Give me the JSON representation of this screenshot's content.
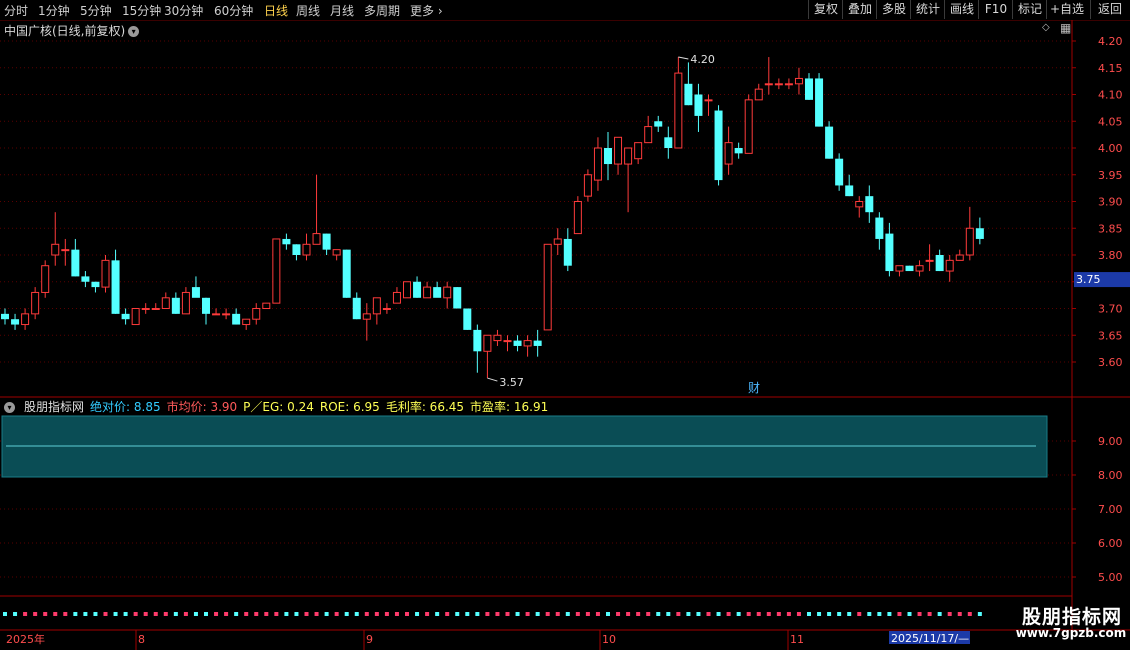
{
  "toolbar": {
    "periods": [
      "分时",
      "1分钟",
      "5分钟",
      "15分钟",
      "30分钟",
      "60分钟",
      "日线",
      "周线",
      "月线",
      "多周期",
      "更多"
    ],
    "active_period": "日线",
    "buttons": [
      "复权",
      "叠加",
      "多股",
      "统计",
      "画线",
      "F10",
      "标记",
      "+自选",
      "返回"
    ]
  },
  "main": {
    "title": "中国广核(日线,前复权)",
    "price_ticks": [
      "4.20",
      "4.15",
      "4.10",
      "4.05",
      "4.00",
      "3.95",
      "3.90",
      "3.85",
      "3.80",
      "3.75",
      "3.70",
      "3.65",
      "3.60"
    ],
    "current_price": "3.75",
    "high_label": "4.20",
    "low_label": "3.57",
    "fin_marker": "财"
  },
  "indicator": {
    "name": "股朋指标网",
    "fields": [
      {
        "label": "绝对价:",
        "value": "8.85",
        "color": "#33ccff"
      },
      {
        "label": "市均价:",
        "value": "3.90",
        "color": "#ff5a5a"
      },
      {
        "label": "P／EG:",
        "value": "0.24",
        "color": "#ffff55"
      },
      {
        "label": "ROE:",
        "value": "6.95",
        "color": "#ffff55"
      },
      {
        "label": "毛利率:",
        "value": "66.45",
        "color": "#ffff55"
      },
      {
        "label": "市盈率:",
        "value": "16.91",
        "color": "#ffff55"
      }
    ],
    "ticks": [
      "9.00",
      "8.00",
      "7.00",
      "6.00",
      "5.00"
    ]
  },
  "date_axis": {
    "labels": [
      "2025年",
      "8",
      "9",
      "10",
      "11"
    ],
    "cursor_date": "2025/11/17/—"
  },
  "watermark": {
    "name": "股朋指标网",
    "url": "www.7gpzb.com"
  },
  "colors": {
    "up": "#ff3b3b",
    "down": "#54ffff",
    "grid": "#5a0000",
    "axis": "#a00000"
  },
  "chart_data": {
    "type": "candlestick",
    "ylim": [
      3.56,
      4.22
    ],
    "candles": [
      {
        "o": 3.69,
        "h": 3.7,
        "l": 3.67,
        "c": 3.68
      },
      {
        "o": 3.68,
        "h": 3.69,
        "l": 3.66,
        "c": 3.67
      },
      {
        "o": 3.67,
        "h": 3.7,
        "l": 3.66,
        "c": 3.69
      },
      {
        "o": 3.69,
        "h": 3.74,
        "l": 3.68,
        "c": 3.73
      },
      {
        "o": 3.73,
        "h": 3.79,
        "l": 3.72,
        "c": 3.78
      },
      {
        "o": 3.8,
        "h": 3.88,
        "l": 3.78,
        "c": 3.82
      },
      {
        "o": 3.81,
        "h": 3.83,
        "l": 3.78,
        "c": 3.81
      },
      {
        "o": 3.81,
        "h": 3.83,
        "l": 3.76,
        "c": 3.76
      },
      {
        "o": 3.76,
        "h": 3.77,
        "l": 3.74,
        "c": 3.75
      },
      {
        "o": 3.75,
        "h": 3.75,
        "l": 3.73,
        "c": 3.74
      },
      {
        "o": 3.74,
        "h": 3.8,
        "l": 3.73,
        "c": 3.79
      },
      {
        "o": 3.79,
        "h": 3.81,
        "l": 3.69,
        "c": 3.69
      },
      {
        "o": 3.69,
        "h": 3.7,
        "l": 3.67,
        "c": 3.68
      },
      {
        "o": 3.67,
        "h": 3.7,
        "l": 3.67,
        "c": 3.7
      },
      {
        "o": 3.7,
        "h": 3.71,
        "l": 3.69,
        "c": 3.7
      },
      {
        "o": 3.7,
        "h": 3.71,
        "l": 3.7,
        "c": 3.7
      },
      {
        "o": 3.7,
        "h": 3.73,
        "l": 3.7,
        "c": 3.72
      },
      {
        "o": 3.72,
        "h": 3.73,
        "l": 3.69,
        "c": 3.69
      },
      {
        "o": 3.69,
        "h": 3.74,
        "l": 3.69,
        "c": 3.73
      },
      {
        "o": 3.74,
        "h": 3.76,
        "l": 3.73,
        "c": 3.72
      },
      {
        "o": 3.72,
        "h": 3.72,
        "l": 3.67,
        "c": 3.69
      },
      {
        "o": 3.69,
        "h": 3.7,
        "l": 3.69,
        "c": 3.69
      },
      {
        "o": 3.69,
        "h": 3.7,
        "l": 3.68,
        "c": 3.69
      },
      {
        "o": 3.69,
        "h": 3.7,
        "l": 3.67,
        "c": 3.67
      },
      {
        "o": 3.67,
        "h": 3.68,
        "l": 3.66,
        "c": 3.68
      },
      {
        "o": 3.68,
        "h": 3.71,
        "l": 3.67,
        "c": 3.7
      },
      {
        "o": 3.7,
        "h": 3.71,
        "l": 3.7,
        "c": 3.71
      },
      {
        "o": 3.71,
        "h": 3.83,
        "l": 3.71,
        "c": 3.83
      },
      {
        "o": 3.83,
        "h": 3.84,
        "l": 3.81,
        "c": 3.82
      },
      {
        "o": 3.82,
        "h": 3.82,
        "l": 3.79,
        "c": 3.8
      },
      {
        "o": 3.8,
        "h": 3.84,
        "l": 3.79,
        "c": 3.82
      },
      {
        "o": 3.82,
        "h": 3.95,
        "l": 3.82,
        "c": 3.84
      },
      {
        "o": 3.84,
        "h": 3.84,
        "l": 3.8,
        "c": 3.81
      },
      {
        "o": 3.8,
        "h": 3.81,
        "l": 3.79,
        "c": 3.81
      },
      {
        "o": 3.81,
        "h": 3.81,
        "l": 3.72,
        "c": 3.72
      },
      {
        "o": 3.72,
        "h": 3.73,
        "l": 3.68,
        "c": 3.68
      },
      {
        "o": 3.68,
        "h": 3.71,
        "l": 3.64,
        "c": 3.69
      },
      {
        "o": 3.69,
        "h": 3.72,
        "l": 3.67,
        "c": 3.72
      },
      {
        "o": 3.7,
        "h": 3.71,
        "l": 3.69,
        "c": 3.7
      },
      {
        "o": 3.71,
        "h": 3.74,
        "l": 3.71,
        "c": 3.73
      },
      {
        "o": 3.72,
        "h": 3.75,
        "l": 3.72,
        "c": 3.75
      },
      {
        "o": 3.75,
        "h": 3.76,
        "l": 3.72,
        "c": 3.72
      },
      {
        "o": 3.72,
        "h": 3.75,
        "l": 3.72,
        "c": 3.74
      },
      {
        "o": 3.74,
        "h": 3.75,
        "l": 3.73,
        "c": 3.72
      },
      {
        "o": 3.72,
        "h": 3.75,
        "l": 3.7,
        "c": 3.74
      },
      {
        "o": 3.74,
        "h": 3.74,
        "l": 3.7,
        "c": 3.7
      },
      {
        "o": 3.7,
        "h": 3.7,
        "l": 3.66,
        "c": 3.66
      },
      {
        "o": 3.66,
        "h": 3.67,
        "l": 3.58,
        "c": 3.62
      },
      {
        "o": 3.62,
        "h": 3.65,
        "l": 3.57,
        "c": 3.65
      },
      {
        "o": 3.64,
        "h": 3.66,
        "l": 3.63,
        "c": 3.65
      },
      {
        "o": 3.64,
        "h": 3.65,
        "l": 3.62,
        "c": 3.64
      },
      {
        "o": 3.64,
        "h": 3.65,
        "l": 3.62,
        "c": 3.63
      },
      {
        "o": 3.63,
        "h": 3.65,
        "l": 3.61,
        "c": 3.64
      },
      {
        "o": 3.64,
        "h": 3.66,
        "l": 3.61,
        "c": 3.63
      },
      {
        "o": 3.66,
        "h": 3.82,
        "l": 3.66,
        "c": 3.82
      },
      {
        "o": 3.82,
        "h": 3.85,
        "l": 3.8,
        "c": 3.83
      },
      {
        "o": 3.83,
        "h": 3.85,
        "l": 3.77,
        "c": 3.78
      },
      {
        "o": 3.84,
        "h": 3.91,
        "l": 3.84,
        "c": 3.9
      },
      {
        "o": 3.91,
        "h": 3.96,
        "l": 3.9,
        "c": 3.95
      },
      {
        "o": 3.94,
        "h": 4.02,
        "l": 3.92,
        "c": 4.0
      },
      {
        "o": 4.0,
        "h": 4.03,
        "l": 3.94,
        "c": 3.97
      },
      {
        "o": 3.97,
        "h": 4.02,
        "l": 3.95,
        "c": 4.02
      },
      {
        "o": 3.97,
        "h": 4.0,
        "l": 3.88,
        "c": 4.0
      },
      {
        "o": 3.98,
        "h": 4.01,
        "l": 3.97,
        "c": 4.01
      },
      {
        "o": 4.01,
        "h": 4.06,
        "l": 4.01,
        "c": 4.04
      },
      {
        "o": 4.05,
        "h": 4.06,
        "l": 4.03,
        "c": 4.04
      },
      {
        "o": 4.02,
        "h": 4.04,
        "l": 3.98,
        "c": 4.0
      },
      {
        "o": 4.0,
        "h": 4.17,
        "l": 4.0,
        "c": 4.14
      },
      {
        "o": 4.12,
        "h": 4.16,
        "l": 4.08,
        "c": 4.08
      },
      {
        "o": 4.1,
        "h": 4.12,
        "l": 4.03,
        "c": 4.06
      },
      {
        "o": 4.09,
        "h": 4.1,
        "l": 4.06,
        "c": 4.09
      },
      {
        "o": 4.07,
        "h": 4.08,
        "l": 3.93,
        "c": 3.94
      },
      {
        "o": 3.97,
        "h": 4.04,
        "l": 3.95,
        "c": 4.01
      },
      {
        "o": 4.0,
        "h": 4.01,
        "l": 3.98,
        "c": 3.99
      },
      {
        "o": 3.99,
        "h": 4.1,
        "l": 3.99,
        "c": 4.09
      },
      {
        "o": 4.09,
        "h": 4.12,
        "l": 4.09,
        "c": 4.11
      },
      {
        "o": 4.12,
        "h": 4.17,
        "l": 4.1,
        "c": 4.12
      },
      {
        "o": 4.12,
        "h": 4.13,
        "l": 4.11,
        "c": 4.12
      },
      {
        "o": 4.12,
        "h": 4.13,
        "l": 4.11,
        "c": 4.12
      },
      {
        "o": 4.12,
        "h": 4.15,
        "l": 4.1,
        "c": 4.13
      },
      {
        "o": 4.13,
        "h": 4.14,
        "l": 4.09,
        "c": 4.09
      },
      {
        "o": 4.13,
        "h": 4.14,
        "l": 4.04,
        "c": 4.04
      },
      {
        "o": 4.04,
        "h": 4.05,
        "l": 3.98,
        "c": 3.98
      },
      {
        "o": 3.98,
        "h": 3.99,
        "l": 3.92,
        "c": 3.93
      },
      {
        "o": 3.93,
        "h": 3.95,
        "l": 3.91,
        "c": 3.91
      },
      {
        "o": 3.89,
        "h": 3.91,
        "l": 3.87,
        "c": 3.9
      },
      {
        "o": 3.91,
        "h": 3.93,
        "l": 3.86,
        "c": 3.88
      },
      {
        "o": 3.87,
        "h": 3.88,
        "l": 3.81,
        "c": 3.83
      },
      {
        "o": 3.84,
        "h": 3.86,
        "l": 3.76,
        "c": 3.77
      },
      {
        "o": 3.77,
        "h": 3.78,
        "l": 3.76,
        "c": 3.78
      },
      {
        "o": 3.78,
        "h": 3.78,
        "l": 3.77,
        "c": 3.77
      },
      {
        "o": 3.77,
        "h": 3.79,
        "l": 3.76,
        "c": 3.78
      },
      {
        "o": 3.79,
        "h": 3.82,
        "l": 3.77,
        "c": 3.79
      },
      {
        "o": 3.8,
        "h": 3.81,
        "l": 3.77,
        "c": 3.77
      },
      {
        "o": 3.77,
        "h": 3.8,
        "l": 3.75,
        "c": 3.79
      },
      {
        "o": 3.79,
        "h": 3.81,
        "l": 3.79,
        "c": 3.8
      },
      {
        "o": 3.8,
        "h": 3.89,
        "l": 3.79,
        "c": 3.85
      },
      {
        "o": 3.85,
        "h": 3.87,
        "l": 3.82,
        "c": 3.83
      }
    ]
  }
}
